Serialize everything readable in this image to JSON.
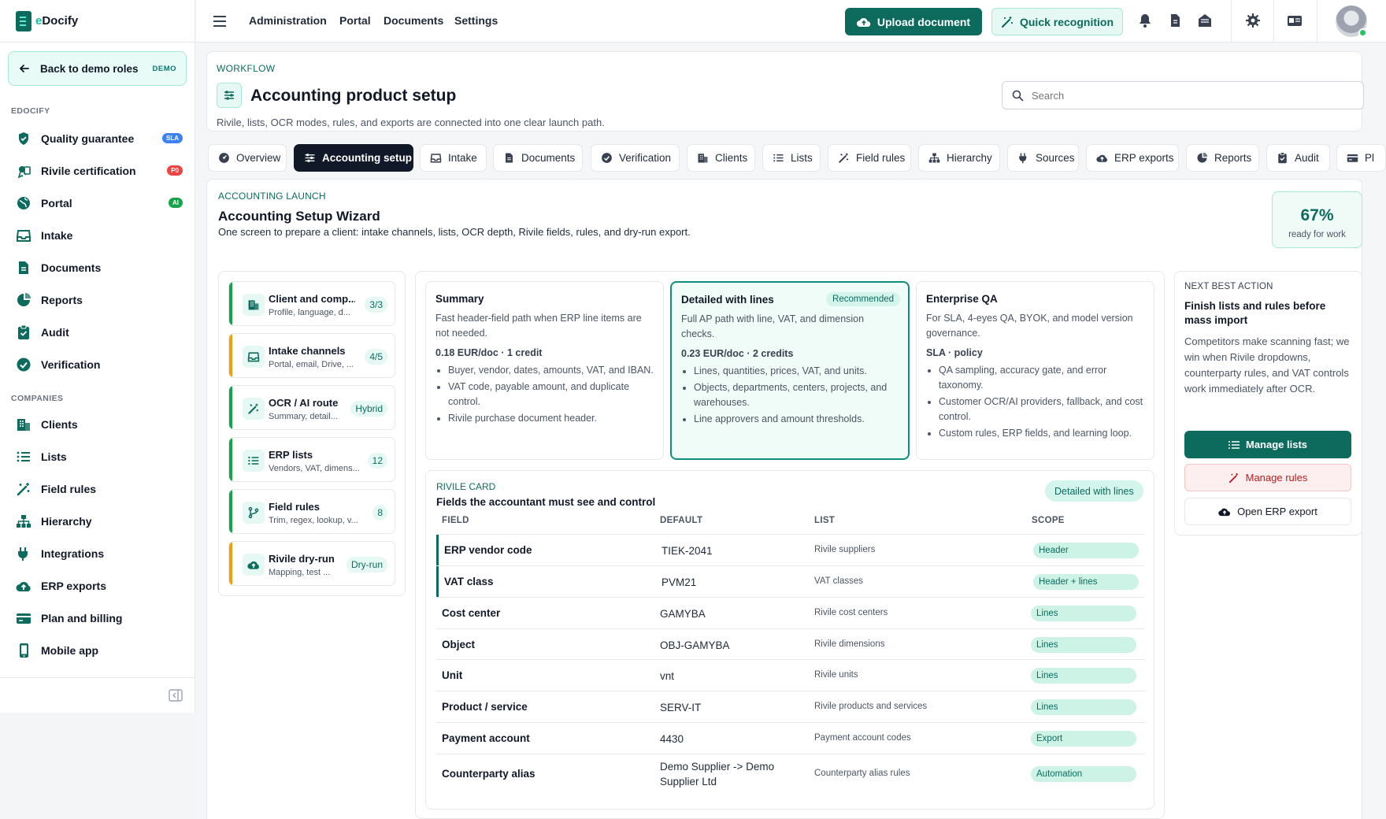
{
  "app": {
    "brand_prefix": "e",
    "brand_name": "Docify"
  },
  "sidebar": {
    "back_label": "Back to demo roles",
    "back_badge": "DEMO",
    "section_edocify": "EDOCIFY",
    "section_companies": "COMPANIES",
    "items_edocify": [
      {
        "label": "Quality guarantee",
        "icon": "shield-icon",
        "badge": "SLA",
        "badge_color": "#3b82f6"
      },
      {
        "label": "Rivile certification",
        "icon": "certificate-icon",
        "badge": "P0",
        "badge_color": "#ef4444"
      },
      {
        "label": "Portal",
        "icon": "globe-icon",
        "badge": "AI",
        "badge_color": "#16a34a"
      },
      {
        "label": "Intake",
        "icon": "inbox-icon"
      },
      {
        "label": "Documents",
        "icon": "document-icon"
      },
      {
        "label": "Reports",
        "icon": "pie-chart-icon"
      },
      {
        "label": "Audit",
        "icon": "clipboard-check-icon"
      },
      {
        "label": "Verification",
        "icon": "check-circle-icon"
      }
    ],
    "items_companies": [
      {
        "label": "Clients",
        "icon": "building-icon"
      },
      {
        "label": "Lists",
        "icon": "list-icon"
      },
      {
        "label": "Field rules",
        "icon": "magic-wand-icon"
      },
      {
        "label": "Hierarchy",
        "icon": "hierarchy-icon"
      },
      {
        "label": "Integrations",
        "icon": "plug-icon"
      },
      {
        "label": "ERP exports",
        "icon": "cloud-upload-icon"
      },
      {
        "label": "Plan and billing",
        "icon": "credit-card-icon"
      },
      {
        "label": "Mobile app",
        "icon": "mobile-icon"
      }
    ]
  },
  "topbar": {
    "nav": [
      "Administration",
      "Portal",
      "Documents",
      "Settings"
    ],
    "upload_label": "Upload document",
    "quick_label": "Quick recognition"
  },
  "header": {
    "eyebrow": "WORKFLOW",
    "title": "Accounting product setup",
    "subtitle": "Rivile, lists, OCR modes, rules, and exports are connected into one clear launch path.",
    "search_placeholder": "Search"
  },
  "tabs": [
    {
      "label": "Overview",
      "icon": "dashboard-icon"
    },
    {
      "label": "Accounting setup",
      "icon": "sliders-icon",
      "active": true
    },
    {
      "label": "Intake",
      "icon": "inbox-icon"
    },
    {
      "label": "Documents",
      "icon": "document-icon"
    },
    {
      "label": "Verification",
      "icon": "check-circle-icon"
    },
    {
      "label": "Clients",
      "icon": "building-icon"
    },
    {
      "label": "Lists",
      "icon": "list-icon"
    },
    {
      "label": "Field rules",
      "icon": "magic-wand-icon"
    },
    {
      "label": "Hierarchy",
      "icon": "hierarchy-icon"
    },
    {
      "label": "Sources",
      "icon": "plug-icon"
    },
    {
      "label": "ERP exports",
      "icon": "cloud-upload-icon"
    },
    {
      "label": "Reports",
      "icon": "pie-chart-icon"
    },
    {
      "label": "Audit",
      "icon": "clipboard-check-icon"
    },
    {
      "label": "Pl",
      "icon": "credit-card-icon"
    }
  ],
  "launch": {
    "eyebrow": "ACCOUNTING LAUNCH",
    "title": "Accounting Setup Wizard",
    "subtitle": "One screen to prepare a client: intake channels, lists, OCR depth, Rivile fields, rules, and dry-run export.",
    "ready_value": "67%",
    "ready_label": "ready for work"
  },
  "steps": [
    {
      "title": "Client and comp...",
      "sub": "Profile, language, d...",
      "count": "3/3",
      "bar": "#16a34a",
      "icon": "building-icon"
    },
    {
      "title": "Intake channels",
      "sub": "Portal, email, Drive, ...",
      "count": "4/5",
      "bar": "#f59e0b",
      "icon": "inbox-icon"
    },
    {
      "title": "OCR / AI route",
      "sub": "Summary, detail...",
      "count": "Hybrid",
      "bar": "#16a34a",
      "icon": "magic-wand-icon"
    },
    {
      "title": "ERP lists",
      "sub": "Vendors, VAT, dimens...",
      "count": "12",
      "bar": "#16a34a",
      "icon": "list-icon"
    },
    {
      "title": "Field rules",
      "sub": "Trim, regex, lookup, v...",
      "count": "8",
      "bar": "#16a34a",
      "icon": "branch-icon"
    },
    {
      "title": "Rivile dry-run",
      "sub": "Mapping, test ...",
      "count": "Dry-run",
      "bar": "#f59e0b",
      "icon": "cloud-upload-icon"
    }
  ],
  "plans": [
    {
      "title": "Summary",
      "desc": "Fast header-field path when ERP line items are not needed.",
      "price": "0.18 EUR/doc · 1 credit",
      "bullets": [
        "Buyer, vendor, dates, amounts, VAT, and IBAN.",
        "VAT code, payable amount, and duplicate control.",
        "Rivile purchase document header."
      ]
    },
    {
      "title": "Detailed with lines",
      "badge": "Recommended",
      "desc": "Full AP path with line, VAT, and dimension checks.",
      "price": "0.23 EUR/doc · 2 credits",
      "bullets": [
        "Lines, quantities, prices, VAT, and units.",
        "Objects, departments, centers, projects, and warehouses.",
        "Line approvers and amount thresholds."
      ]
    },
    {
      "title": "Enterprise QA",
      "desc": "For SLA, 4-eyes QA, BYOK, and model version governance.",
      "price": "SLA · policy",
      "bullets": [
        "QA sampling, accuracy gate, and error taxonomy.",
        "Customer OCR/AI providers, fallback, and cost control.",
        "Custom rules, ERP fields, and learning loop."
      ]
    }
  ],
  "rivile": {
    "eyebrow": "RIVILE CARD",
    "title": "Fields the accountant must see and control",
    "mode_badge": "Detailed with lines",
    "columns": [
      "FIELD",
      "DEFAULT",
      "LIST",
      "SCOPE"
    ],
    "rows": [
      {
        "field": "ERP vendor code",
        "default": "TIEK-2041",
        "list": "Rivile suppliers",
        "scope": "Header",
        "marked": true
      },
      {
        "field": "VAT class",
        "default": "PVM21",
        "list": "VAT classes",
        "scope": "Header + lines",
        "marked": true
      },
      {
        "field": "Cost center",
        "default": "GAMYBA",
        "list": "Rivile cost centers",
        "scope": "Lines"
      },
      {
        "field": "Object",
        "default": "OBJ-GAMYBA",
        "list": "Rivile dimensions",
        "scope": "Lines"
      },
      {
        "field": "Unit",
        "default": "vnt",
        "list": "Rivile units",
        "scope": "Lines"
      },
      {
        "field": "Product / service",
        "default": "SERV-IT",
        "list": "Rivile products and services",
        "scope": "Lines"
      },
      {
        "field": "Payment account",
        "default": "4430",
        "list": "Payment account codes",
        "scope": "Export"
      },
      {
        "field": "Counterparty alias",
        "default": "Demo Supplier -> Demo Supplier Ltd",
        "list": "Counterparty alias rules",
        "scope": "Automation"
      }
    ]
  },
  "next_action": {
    "eyebrow": "NEXT BEST ACTION",
    "title": "Finish lists and rules before mass import",
    "desc": "Competitors make scanning fast; we win when Rivile dropdowns, counterparty rules, and VAT controls work immediately after OCR.",
    "btn_lists": "Manage lists",
    "btn_rules": "Manage rules",
    "btn_export": "Open ERP export"
  }
}
